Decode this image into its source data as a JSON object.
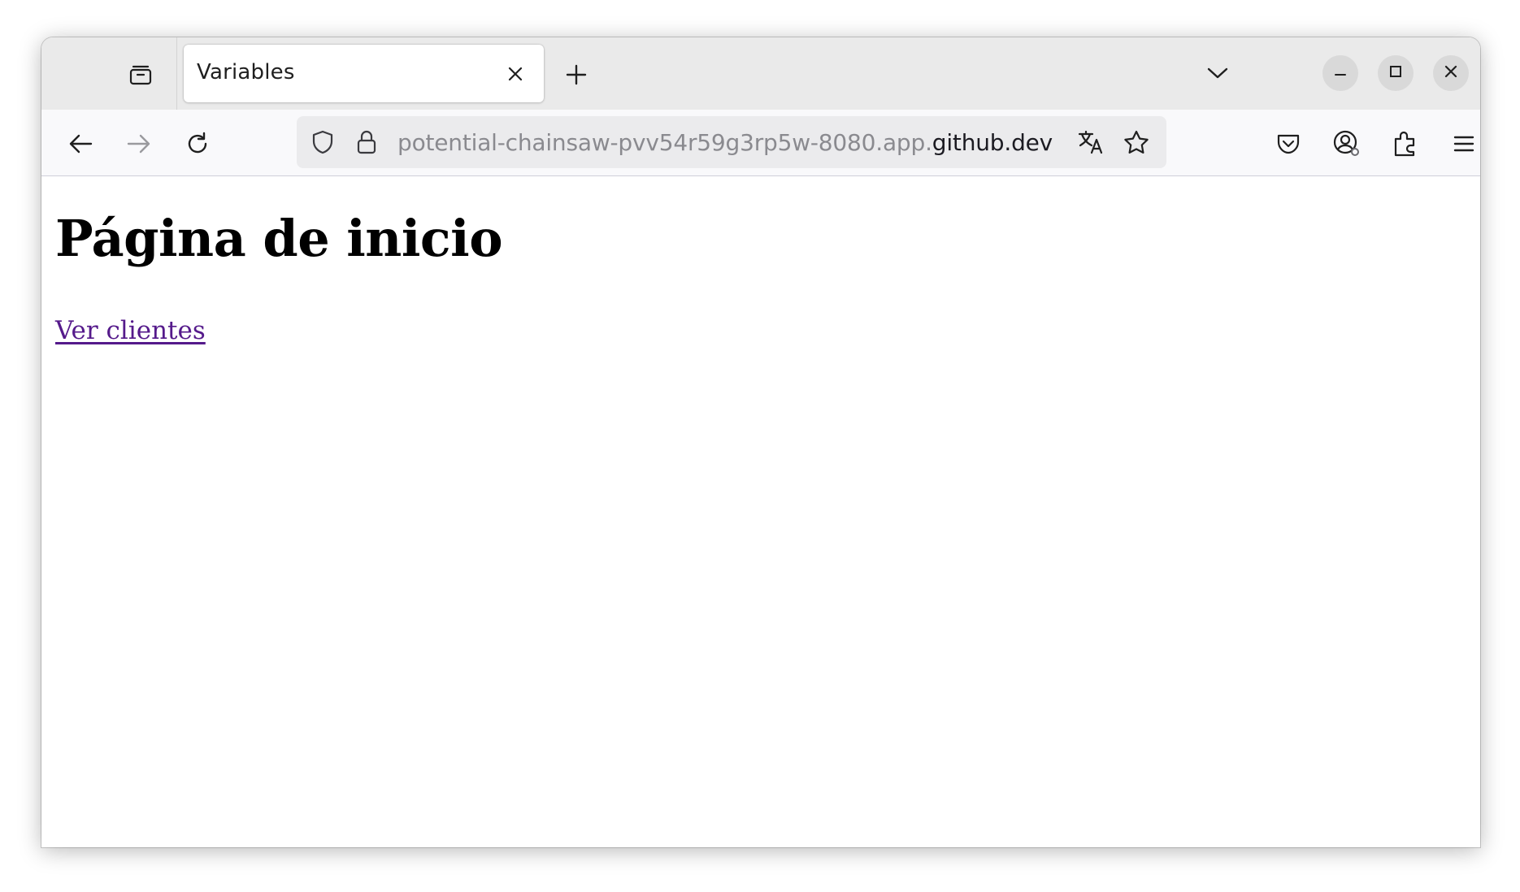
{
  "browser": {
    "tab": {
      "title": "Variables",
      "close_icon": "close-icon"
    },
    "tab_strip": {
      "tab_groups_icon": "folder-tray-icon",
      "new_tab_icon": "plus-icon",
      "list_all_tabs_icon": "chevron-down-icon"
    },
    "window_controls": {
      "minimize_icon": "minimize-icon",
      "maximize_icon": "maximize-icon",
      "close_icon": "close-icon"
    },
    "nav": {
      "back_icon": "arrow-left-icon",
      "forward_icon": "arrow-right-icon",
      "reload_icon": "reload-icon"
    },
    "urlbar": {
      "url_prefix": "potential-chainsaw-pvv54r59g3rp5w-8080.app.",
      "url_domain": "github.dev",
      "tracking_icon": "shield-icon",
      "lock_icon": "lock-icon",
      "translate_icon": "translate-icon",
      "bookmark_icon": "star-icon"
    },
    "toolbar": {
      "pocket_icon": "pocket-icon",
      "account_icon": "account-icon",
      "extensions_icon": "puzzle-icon",
      "menu_icon": "hamburger-menu-icon"
    },
    "colors": {
      "tabstrip_bg": "#eaeaea",
      "navbar_bg": "#f9f9fb",
      "urlbar_bg": "#ebebed",
      "visited_link": "#551a8b"
    }
  },
  "page": {
    "heading": "Página de inicio",
    "link_text": "Ver clientes"
  }
}
